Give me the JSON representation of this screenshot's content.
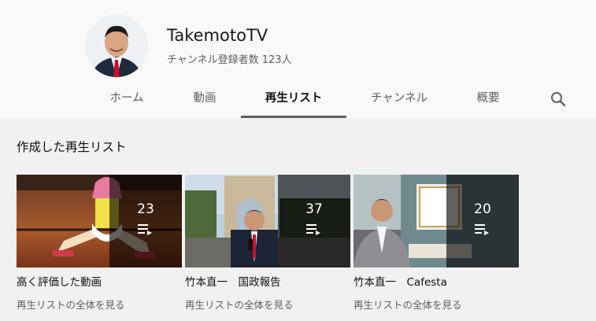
{
  "channel": {
    "name": "TakemotoTV",
    "subscribers": "チャンネル登録者数 123人"
  },
  "tabs": [
    {
      "label": "ホーム",
      "active": false
    },
    {
      "label": "動画",
      "active": false
    },
    {
      "label": "再生リスト",
      "active": true
    },
    {
      "label": "チャンネル",
      "active": false
    },
    {
      "label": "概要",
      "active": false
    }
  ],
  "icons": {
    "search": "search-icon",
    "playlist": "playlist-icon"
  },
  "section": {
    "title": "作成した再生リスト"
  },
  "playlists": [
    {
      "title": "高く評価した動画",
      "count": "23",
      "view_all": "再生リストの全体を見る"
    },
    {
      "title": "竹本直一　国政報告",
      "count": "37",
      "view_all": "再生リストの全体を見る"
    },
    {
      "title": "竹本直一　Cafesta",
      "count": "20",
      "view_all": "再生リストの全体を見る"
    }
  ],
  "colors": {
    "accent_underline": "#606060",
    "overlay": "#000000"
  }
}
